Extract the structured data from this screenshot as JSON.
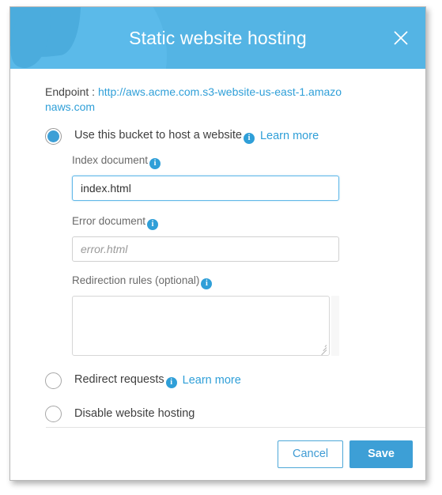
{
  "dialog": {
    "title": "Static website hosting",
    "close_label": "Close",
    "endpoint": {
      "label": "Endpoint :",
      "url": "http://aws.acme.com.s3-website-us-east-1.amazonaws.com"
    },
    "options": [
      {
        "id": "use-bucket",
        "label": "Use this bucket to host a website",
        "selected": true,
        "info": "i",
        "learn_more": "Learn more"
      },
      {
        "id": "redirect-requests",
        "label": "Redirect requests",
        "selected": false,
        "info": "i",
        "learn_more": "Learn more"
      },
      {
        "id": "disable-hosting",
        "label": "Disable website hosting",
        "selected": false
      }
    ],
    "fields": {
      "index_document": {
        "label": "Index document",
        "info": "i",
        "value": "index.html",
        "placeholder": ""
      },
      "error_document": {
        "label": "Error document",
        "info": "i",
        "value": "",
        "placeholder": "error.html"
      },
      "redirection_rules": {
        "label": "Redirection rules (optional)",
        "info": "i",
        "value": "",
        "placeholder": ""
      }
    },
    "footer": {
      "cancel_label": "Cancel",
      "save_label": "Save"
    }
  },
  "colors": {
    "header_blue": "#54b4e4",
    "accent_blue": "#3d9fd6",
    "link_blue": "#2f9fd8",
    "label_gray": "#6a6a6a",
    "text_dark": "#3f3f3f"
  }
}
